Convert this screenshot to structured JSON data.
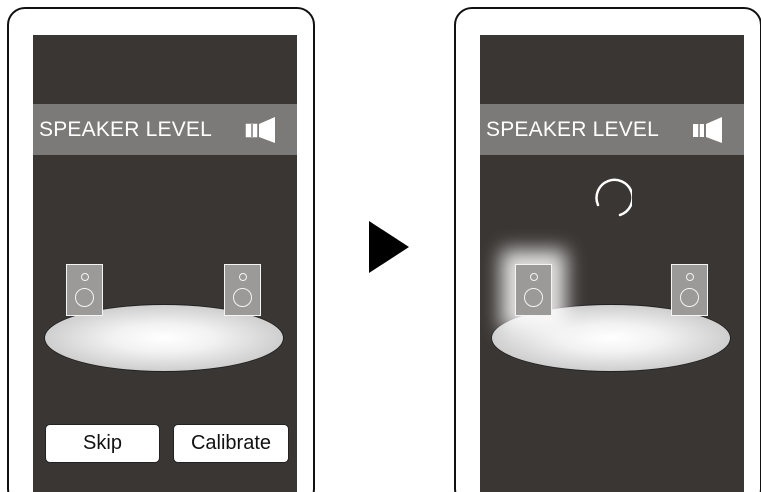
{
  "left_screen": {
    "header_title": "SPEAKER LEVEL",
    "buttons": {
      "skip_label": "Skip",
      "calibrate_label": "Calibrate"
    }
  },
  "right_screen": {
    "header_title": "SPEAKER LEVEL",
    "state": "calibrating",
    "active_speaker": "front-left"
  },
  "icons": {
    "header_icon": "speaker-icon",
    "transition": "play-arrow-icon",
    "loading": "spinner-icon"
  },
  "colors": {
    "screen_bg": "#3a3634",
    "header_bg": "#7c7a79",
    "speaker_fill": "#9c9a99"
  }
}
